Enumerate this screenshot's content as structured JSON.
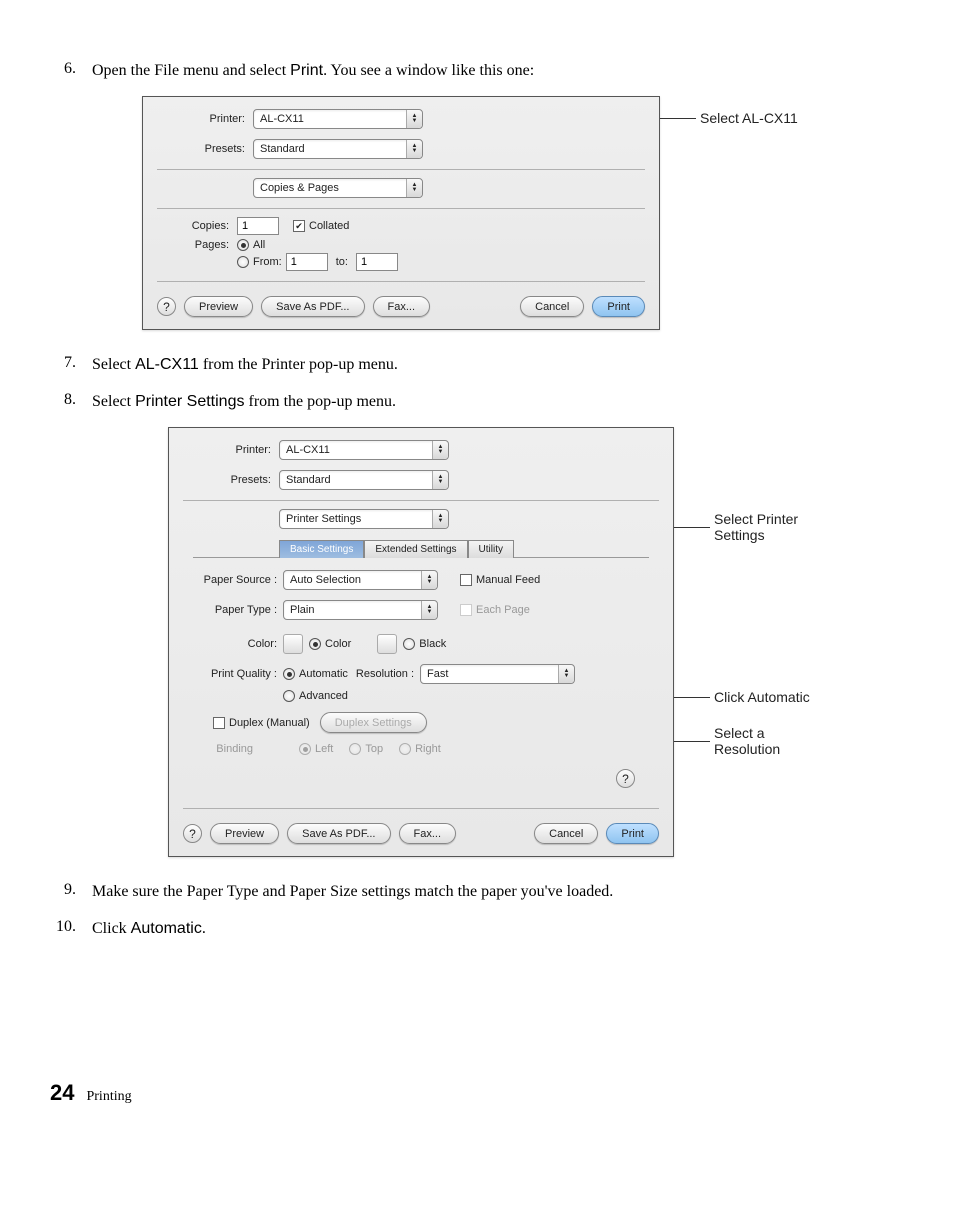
{
  "steps": {
    "s6": {
      "num": "6.",
      "text_a": "Open the File menu and select ",
      "bold": "Print",
      "text_b": ". You see a window like this one:"
    },
    "s7": {
      "num": "7.",
      "text_a": "Select ",
      "bold": "AL-CX11",
      "text_b": " from the Printer pop-up menu."
    },
    "s8": {
      "num": "8.",
      "text_a": "Select ",
      "bold": "Printer Settings",
      "text_b": " from the pop-up menu."
    },
    "s9": {
      "num": "9.",
      "text": "Make sure the Paper Type and Paper Size settings match the paper you've loaded."
    },
    "s10": {
      "num": "10.",
      "text_a": "Click ",
      "bold": "Automatic",
      "text_b": "."
    }
  },
  "dlg1": {
    "printer_label": "Printer:",
    "printer_value": "AL-CX11",
    "presets_label": "Presets:",
    "presets_value": "Standard",
    "panel_value": "Copies & Pages",
    "copies_label": "Copies:",
    "copies_value": "1",
    "collated": "Collated",
    "pages_label": "Pages:",
    "all": "All",
    "from": "From:",
    "from_value": "1",
    "to": "to:",
    "to_value": "1",
    "help": "?",
    "preview": "Preview",
    "save_pdf": "Save As PDF...",
    "fax": "Fax...",
    "cancel": "Cancel",
    "print": "Print"
  },
  "dlg2": {
    "printer_label": "Printer:",
    "printer_value": "AL-CX11",
    "presets_label": "Presets:",
    "presets_value": "Standard",
    "panel_value": "Printer Settings",
    "tab_basic": "Basic Settings",
    "tab_ext": "Extended Settings",
    "tab_util": "Utility",
    "paper_source_label": "Paper Source :",
    "paper_source_value": "Auto Selection",
    "manual_feed": "Manual Feed",
    "paper_type_label": "Paper Type :",
    "paper_type_value": "Plain",
    "each_page": "Each Page",
    "color_label": "Color:",
    "color_opt": "Color",
    "black_opt": "Black",
    "pq_label": "Print Quality :",
    "automatic": "Automatic",
    "resolution_label": "Resolution :",
    "resolution_value": "Fast",
    "advanced": "Advanced",
    "duplex": "Duplex (Manual)",
    "duplex_settings": "Duplex Settings",
    "binding": "Binding",
    "left": "Left",
    "top": "Top",
    "right": "Right",
    "help": "?",
    "preview": "Preview",
    "save_pdf": "Save As PDF...",
    "fax": "Fax...",
    "cancel": "Cancel",
    "print": "Print"
  },
  "annotations": {
    "a1": "Select AL-CX11",
    "a2": "Select Printer Settings",
    "a3": "Click Automatic",
    "a4": "Select a Resolution"
  },
  "footer": {
    "page": "24",
    "title": "Printing"
  }
}
